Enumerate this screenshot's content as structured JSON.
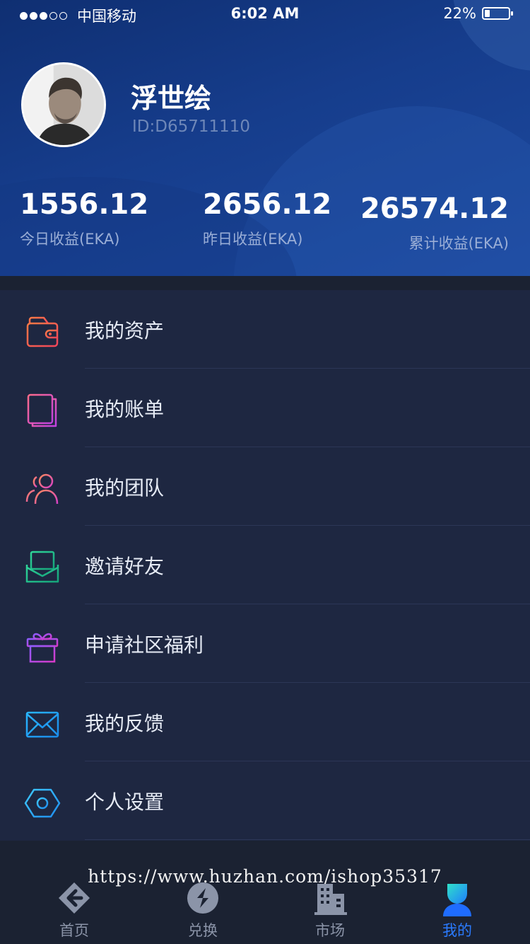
{
  "status_bar": {
    "carrier": "中国移动",
    "time": "6:02 AM",
    "battery_text": "22%",
    "battery_level": 0.22
  },
  "profile": {
    "name": "浮世绘",
    "id": "ID:D65711110"
  },
  "stats": [
    {
      "value": "1556.12",
      "label": "今日收益(EKA)"
    },
    {
      "value": "2656.12",
      "label": "昨日收益(EKA)"
    },
    {
      "value": "26574.12",
      "label": "累计收益(EKA)"
    }
  ],
  "menu": [
    {
      "label": "我的资产",
      "icon": "wallet-icon"
    },
    {
      "label": "我的账单",
      "icon": "bill-icon"
    },
    {
      "label": "我的团队",
      "icon": "team-icon"
    },
    {
      "label": "邀请好友",
      "icon": "invite-mail-icon"
    },
    {
      "label": "申请社区福利",
      "icon": "gift-icon"
    },
    {
      "label": "我的反馈",
      "icon": "envelope-icon"
    },
    {
      "label": "个人设置",
      "icon": "settings-hexagon-icon"
    }
  ],
  "watermark": "https://www.huzhan.com/ishop35317",
  "tabs": [
    {
      "label": "首页",
      "icon": "home-logo-icon",
      "active": false
    },
    {
      "label": "兑换",
      "icon": "exchange-icon",
      "active": false
    },
    {
      "label": "市场",
      "icon": "market-building-icon",
      "active": false
    },
    {
      "label": "我的",
      "icon": "profile-person-icon",
      "active": true
    }
  ],
  "colors": {
    "header": "#163d8c",
    "menu_bg": "#1e2741",
    "active_tab": "#2b7bff",
    "inactive_tab": "#8b94a8"
  }
}
